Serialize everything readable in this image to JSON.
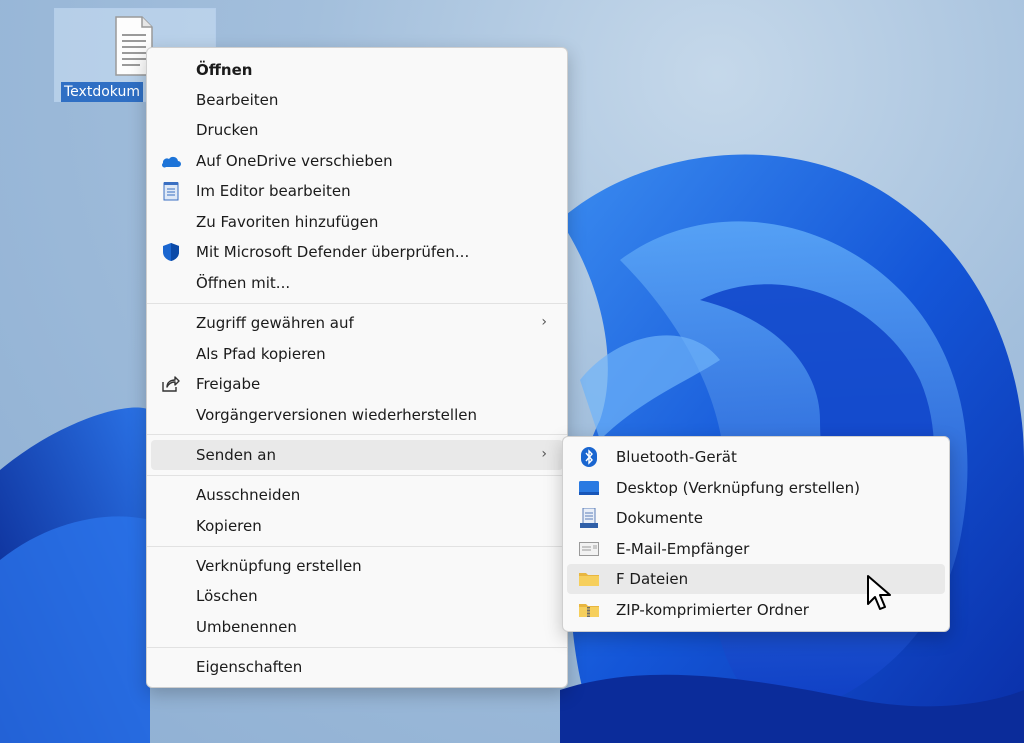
{
  "desktop": {
    "file_icon": {
      "label": "Textdokum",
      "icon": "text-document-icon"
    }
  },
  "context_menu": {
    "groups": [
      [
        {
          "label": "Öffnen",
          "bold": true
        },
        {
          "label": "Bearbeiten"
        },
        {
          "label": "Drucken"
        },
        {
          "label": "Auf OneDrive verschieben",
          "icon": "onedrive-icon"
        },
        {
          "label": "Im Editor bearbeiten",
          "icon": "notepad-icon"
        },
        {
          "label": "Zu Favoriten hinzufügen"
        },
        {
          "label": "Mit Microsoft Defender überprüfen...",
          "icon": "defender-shield-icon"
        },
        {
          "label": "Öffnen mit..."
        }
      ],
      [
        {
          "label": "Zugriff gewähren auf",
          "submenu": true
        },
        {
          "label": "Als Pfad kopieren"
        },
        {
          "label": "Freigabe",
          "icon": "share-icon"
        },
        {
          "label": "Vorgängerversionen wiederherstellen"
        }
      ],
      [
        {
          "label": "Senden an",
          "submenu": true,
          "highlighted": true
        }
      ],
      [
        {
          "label": "Ausschneiden"
        },
        {
          "label": "Kopieren"
        }
      ],
      [
        {
          "label": "Verknüpfung erstellen"
        },
        {
          "label": "Löschen"
        },
        {
          "label": "Umbenennen"
        }
      ],
      [
        {
          "label": "Eigenschaften"
        }
      ]
    ]
  },
  "send_to_submenu": {
    "items": [
      {
        "label": "Bluetooth-Gerät",
        "icon": "bluetooth-icon"
      },
      {
        "label": "Desktop (Verknüpfung erstellen)",
        "icon": "desktop-icon"
      },
      {
        "label": "Dokumente",
        "icon": "documents-icon"
      },
      {
        "label": "E-Mail-Empfänger",
        "icon": "mail-icon"
      },
      {
        "label": "F Dateien",
        "icon": "folder-icon",
        "highlighted": true
      },
      {
        "label": "ZIP-komprimierter Ordner",
        "icon": "zip-folder-icon"
      }
    ]
  },
  "colors": {
    "accent": "#2f6fc4",
    "wallpaper_blue": "#1a5fd6",
    "menu_bg": "#f9f9f9",
    "highlight": "#e9e9e9"
  }
}
